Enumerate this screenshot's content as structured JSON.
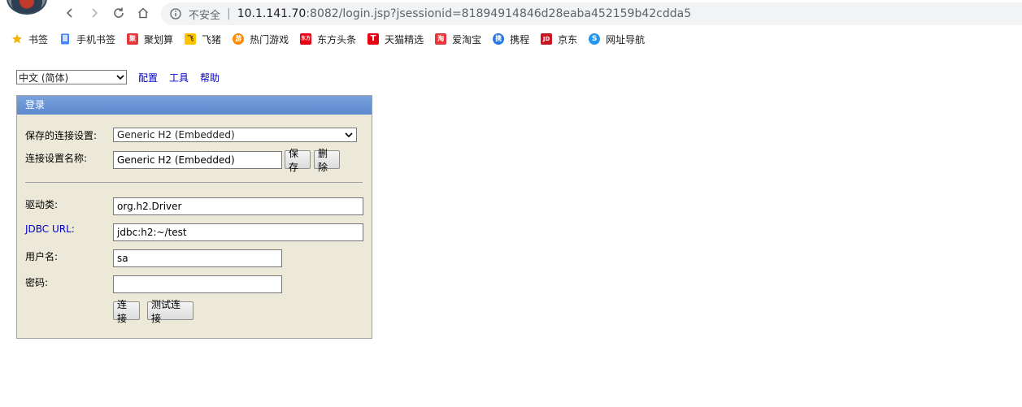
{
  "browser": {
    "address": {
      "insecure_label": "不安全",
      "separator": "|",
      "host": "10.1.141.70",
      "rest": ":8082/login.jsp?jsessionid=81894914846d28eaba452159b42cdda5"
    },
    "bookmarks": [
      {
        "label": "书签",
        "icon": "star-icon",
        "color": "#f4b400"
      },
      {
        "label": "手机书签",
        "icon": "mobile-bookmark-icon",
        "color": "#4285f4"
      },
      {
        "label": "聚划算",
        "icon": "juhuasuan-icon",
        "color": "#e4393c",
        "glyph": "聚"
      },
      {
        "label": "飞猪",
        "icon": "feizhu-icon",
        "color": "#ffc300",
        "glyph": "飞"
      },
      {
        "label": "热门游戏",
        "icon": "game-icon",
        "color": "#ff8a00",
        "glyph": "游"
      },
      {
        "label": "东方头条",
        "icon": "dongfang-icon",
        "color": "#e60012",
        "glyph": "东方"
      },
      {
        "label": "天猫精选",
        "icon": "tmall-icon",
        "color": "#e60012",
        "glyph": "T"
      },
      {
        "label": "爱淘宝",
        "icon": "aitaobao-icon",
        "color": "#e4393c",
        "glyph": "淘"
      },
      {
        "label": "携程",
        "icon": "ctrip-icon",
        "color": "#2577e3",
        "glyph": "携"
      },
      {
        "label": "京东",
        "icon": "jd-icon",
        "color": "#c91623",
        "glyph": "JD"
      },
      {
        "label": "网址导航",
        "icon": "nav-site-icon",
        "color": "#2196f3",
        "glyph": "S"
      }
    ]
  },
  "page": {
    "language_selected": "中文 (简体)",
    "links": {
      "config": "配置",
      "tools": "工具",
      "help": "帮助"
    },
    "panel_title": "登录",
    "saved_settings_label": "保存的连接设置:",
    "saved_settings_value": "Generic H2 (Embedded)",
    "setting_name_label": "连接设置名称:",
    "setting_name_value": "Generic H2 (Embedded)",
    "save_button": "保存",
    "delete_button": "删除",
    "driver_label": "驱动类:",
    "driver_value": "org.h2.Driver",
    "jdbc_label": "JDBC URL:",
    "jdbc_value": "jdbc:h2:~/test",
    "user_label": "用户名:",
    "user_value": "sa",
    "password_label": "密码:",
    "password_value": "",
    "connect_button": "连接",
    "test_button": "测试连接"
  }
}
